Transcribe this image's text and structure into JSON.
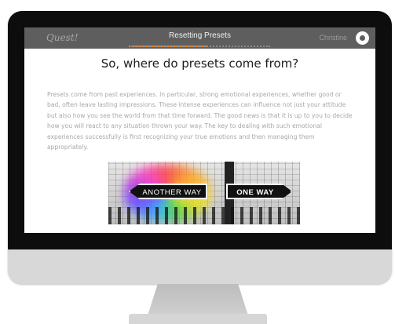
{
  "header": {
    "logo": "Quest!",
    "title": "Resetting Presets",
    "progress_fraction": 0.55,
    "user_name": "Christine"
  },
  "content": {
    "heading": "So, where do presets come from?",
    "paragraph": "Presets come from past experiences. In particular, strong emotional experiences, whether good or bad, often leave lasting impressions. These intense experiences can influence not just your attitude but also how you see the world from that time forward. The good news is that it is up to you to decide how you will react to any situation thrown your way. The key to dealing with such emotional experiences successfully is first recognizing your true emotions and then managing them appropriately.",
    "image": {
      "sign_left": "ANOTHER WAY",
      "sign_right": "ONE WAY"
    }
  },
  "colors": {
    "header_bg": "#5e5e5e",
    "progress_accent": "#e2852f",
    "bezel": "#0d0d0d",
    "monitor_frame": "#d8d8d8"
  }
}
